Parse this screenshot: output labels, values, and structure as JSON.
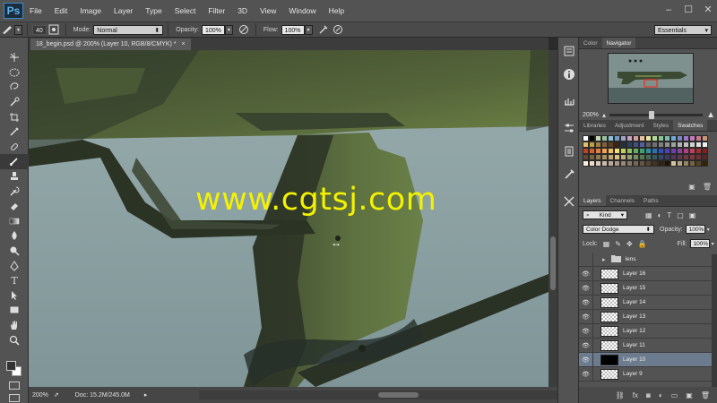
{
  "app": {
    "logo": "Ps"
  },
  "menu": [
    "File",
    "Edit",
    "Image",
    "Layer",
    "Type",
    "Select",
    "Filter",
    "3D",
    "View",
    "Window",
    "Help"
  ],
  "window_controls": [
    "–",
    "☐",
    "✕"
  ],
  "options_bar": {
    "brush_size": "40",
    "mode_label": "Mode:",
    "mode_value": "Normal",
    "opacity_label": "Opacity:",
    "opacity_value": "100%",
    "flow_label": "Flow:",
    "flow_value": "100%",
    "workspace": "Essentials"
  },
  "document": {
    "tab_title": "18_begin.psd @ 200% (Layer 10, RGB/8/CMYK) *",
    "tab_close": "×",
    "zoom": "200%",
    "doc_info": "Doc: 15.2M/245.0M"
  },
  "watermark": "www.cgtsj.com",
  "navigator": {
    "tabs": [
      "Color",
      "Navigator"
    ],
    "active_tab": "Navigator",
    "zoom": "200%",
    "slider_level": 0.45
  },
  "swatches": {
    "tabs": [
      "Libraries",
      "Adjustment",
      "Styles",
      "Swatches"
    ],
    "active_tab": "Swatches",
    "colors": [
      "#ffffff",
      "#000000",
      "#c9d9b4",
      "#99c2a2",
      "#8ec2d7",
      "#6fa0c8",
      "#a7a0c8",
      "#c8a0c0",
      "#d3a0a0",
      "#e8c3a0",
      "#e6e6a0",
      "#b2d99b",
      "#8bc493",
      "#7bbcb5",
      "#74a7d2",
      "#7b86c6",
      "#9b7bc6",
      "#c27bbd",
      "#c87b8f",
      "#c8987b",
      "#e0c060",
      "#c0a040",
      "#a08040",
      "#806040",
      "#604020",
      "#402010",
      "#203040",
      "#304060",
      "#405080",
      "#5060a0",
      "#606060",
      "#707070",
      "#808080",
      "#909090",
      "#a0a0a0",
      "#b0b0b0",
      "#c0c0c0",
      "#d0d0d0",
      "#e0e0e0",
      "#f0f0f0",
      "#c04020",
      "#d06030",
      "#e08040",
      "#f0a050",
      "#f0c060",
      "#f0e070",
      "#c0d060",
      "#90c060",
      "#60b060",
      "#40a070",
      "#3090a0",
      "#3070b0",
      "#3050c0",
      "#5040c0",
      "#7040b0",
      "#9040a0",
      "#b04080",
      "#c04060",
      "#a03030",
      "#802020",
      "#604830",
      "#786040",
      "#907850",
      "#a89060",
      "#c0a870",
      "#d8c080",
      "#b8b080",
      "#98a070",
      "#789060",
      "#587850",
      "#486858",
      "#385860",
      "#384868",
      "#403860",
      "#503858",
      "#603850",
      "#703848",
      "#803840",
      "#703030",
      "#582828",
      "#ffeedd",
      "#eeddcc",
      "#ddccbb",
      "#ccbbaa",
      "#bbaa99",
      "#aa9988",
      "#998877",
      "#887766",
      "#776655",
      "#665544",
      "#554433",
      "#443322",
      "#332211",
      "#221100",
      "#d4c4a4",
      "#b4a484",
      "#948464",
      "#746444",
      "#544424",
      "#342404"
    ]
  },
  "layers_panel": {
    "tabs": [
      "Layers",
      "Channels",
      "Paths"
    ],
    "active_tab": "Layers",
    "filter_kind": "Kind",
    "blend_mode": "Color Dodge",
    "opacity_label": "Opacity:",
    "opacity_value": "100%",
    "lock_label": "Lock:",
    "fill_label": "Fill:",
    "fill_value": "100%",
    "layers": [
      {
        "name": "lens",
        "type": "group",
        "visible": false,
        "selected": false
      },
      {
        "name": "Layer 16",
        "type": "layer",
        "visible": true,
        "selected": false
      },
      {
        "name": "Layer 15",
        "type": "layer",
        "visible": true,
        "selected": false
      },
      {
        "name": "Layer 14",
        "type": "layer",
        "visible": true,
        "selected": false
      },
      {
        "name": "Layer 13",
        "type": "layer",
        "visible": true,
        "selected": false
      },
      {
        "name": "Layer 12",
        "type": "layer",
        "visible": true,
        "selected": false
      },
      {
        "name": "Layer 11",
        "type": "layer",
        "visible": true,
        "selected": false
      },
      {
        "name": "Layer 10",
        "type": "layer",
        "visible": true,
        "selected": true
      },
      {
        "name": "Layer 9",
        "type": "layer",
        "visible": true,
        "selected": false
      }
    ]
  },
  "tools": [
    "move-tool",
    "marquee-tool",
    "lasso-tool",
    "quick-select-tool",
    "crop-tool",
    "eyedropper-tool",
    "healing-brush-tool",
    "brush-tool",
    "clone-stamp-tool",
    "history-brush-tool",
    "eraser-tool",
    "gradient-tool",
    "blur-tool",
    "dodge-tool",
    "pen-tool",
    "type-tool",
    "path-select-tool",
    "rectangle-tool",
    "hand-tool",
    "zoom-tool"
  ],
  "colors": {
    "canvas_sky": "#8a9ea1",
    "gun_green": "#4f5e35",
    "gun_dark": "#2f3b2e",
    "selected_layer": "#6d7b8f",
    "watermark": "#f4f200"
  }
}
